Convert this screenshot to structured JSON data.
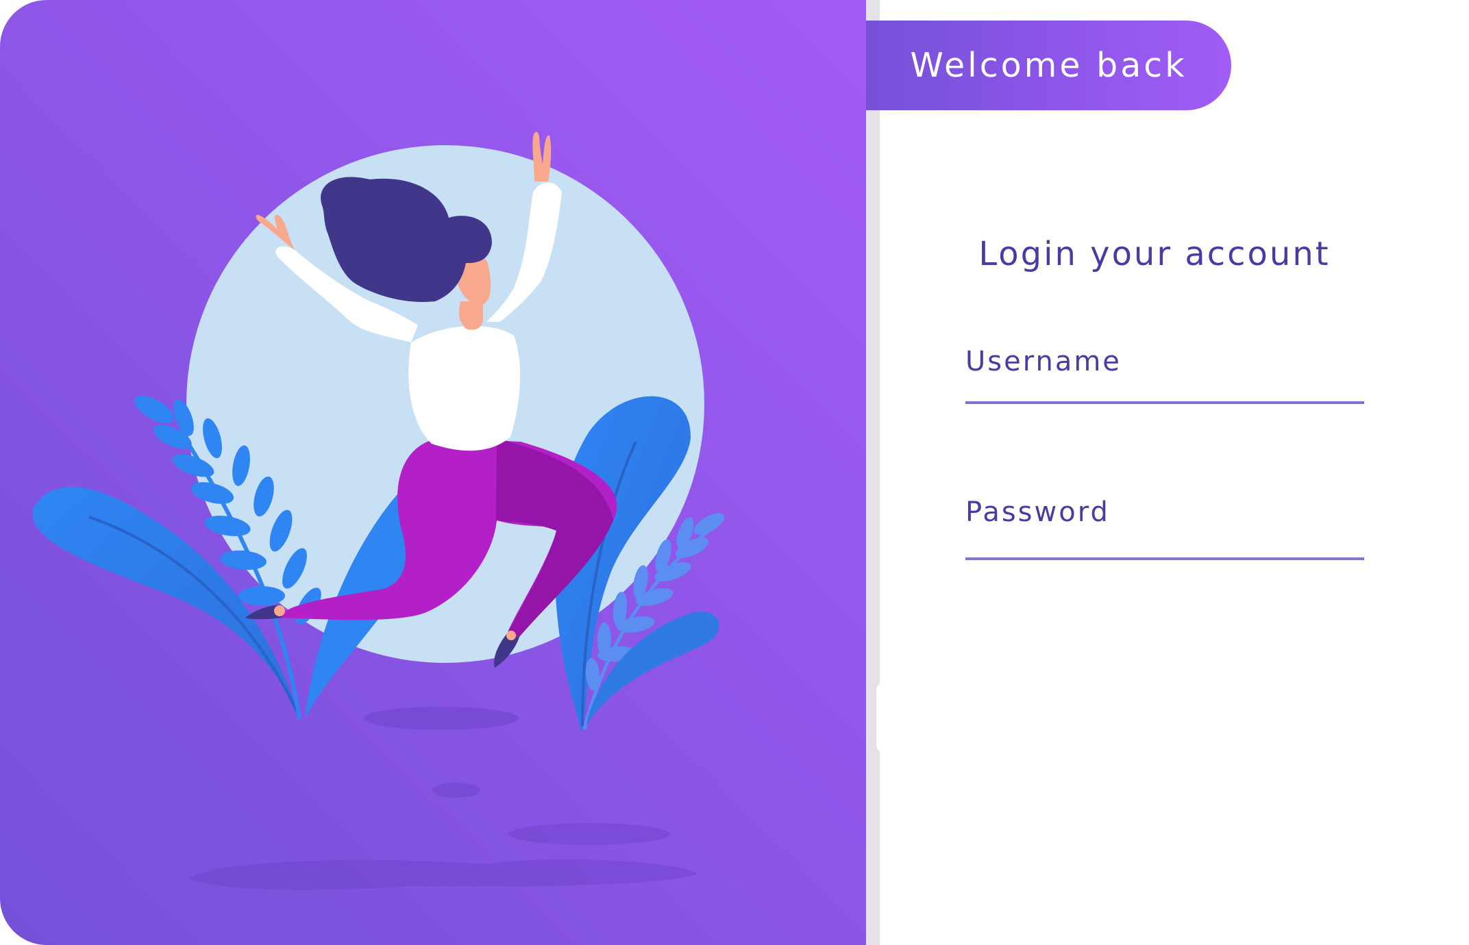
{
  "header": {
    "welcome_label": "Welcome back"
  },
  "illustration": {
    "subject": "person-jumping-with-plants",
    "colors": {
      "background_gradient_start": "#a35cf7",
      "background_gradient_end": "#7451d8",
      "circle": "#c8e0f4",
      "leaves": "#2f7ae5",
      "pants": "#b420c8",
      "hair": "#40378b",
      "shirt": "#ffffff",
      "skin": "#f8a98d"
    }
  },
  "login": {
    "title": "Login your account",
    "username": {
      "label": "Username",
      "value": "",
      "placeholder": ""
    },
    "password": {
      "label": "Password",
      "value": "",
      "placeholder": ""
    }
  },
  "theme": {
    "accent": "#8f56e8",
    "text": "#4a3aa3",
    "underline": "#7f73d5"
  }
}
